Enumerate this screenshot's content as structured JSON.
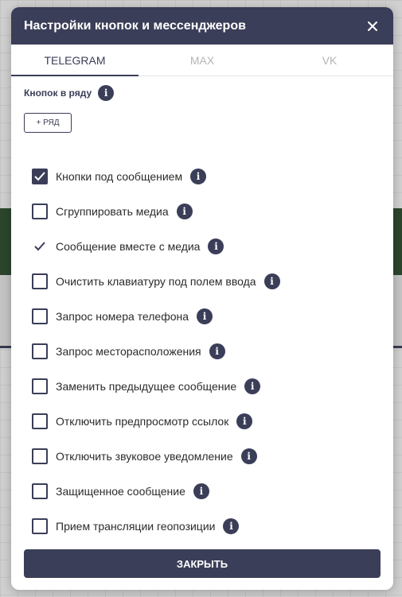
{
  "modal": {
    "title": "Настройки кнопок и мессенджеров",
    "close_icon": "close-icon"
  },
  "tabs": [
    {
      "label": "TELEGRAM",
      "active": true
    },
    {
      "label": "MAX",
      "active": false
    },
    {
      "label": "VK",
      "active": false
    }
  ],
  "buttons_per_row": {
    "label": "Кнопок в ряду",
    "add_row_label": "+ РЯД"
  },
  "options": [
    {
      "label": "Кнопки под сообщением",
      "checked": true
    },
    {
      "label": "Сгруппировать медиа",
      "checked": false
    },
    {
      "label": "Сообщение вместе с медиа",
      "checked": true
    },
    {
      "label": "Очистить клавиатуру под полем ввода",
      "checked": false
    },
    {
      "label": "Запрос номера телефона",
      "checked": false
    },
    {
      "label": "Запрос месторасположения",
      "checked": false
    },
    {
      "label": "Заменить предыдущее сообщение",
      "checked": false
    },
    {
      "label": "Отключить предпросмотр ссылок",
      "checked": false
    },
    {
      "label": "Отключить звуковое уведомление",
      "checked": false
    },
    {
      "label": "Защищенное сообщение",
      "checked": false
    },
    {
      "label": "Прием трансляции геопозиции",
      "checked": false
    }
  ],
  "footer": {
    "close_label": "ЗАКРЫТЬ"
  },
  "colors": {
    "primary": "#3b3e58",
    "tab_inactive": "#b5b5b5"
  }
}
